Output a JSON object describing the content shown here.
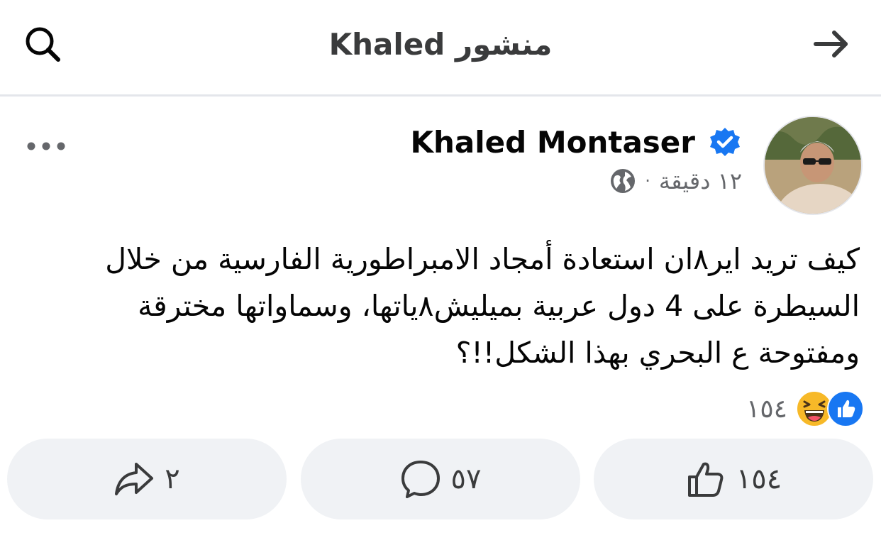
{
  "header": {
    "title": "منشور Khaled"
  },
  "post": {
    "author": "Khaled Montaser",
    "time": "١٢ دقيقة",
    "separator": "·",
    "text": "كيف تريد اير٨ان استعادة أمجاد الامبراطورية الفارسية من خلال السيطرة على 4 دول عربية بميليش٨ياتها، وسماواتها مخترقة ومفتوحة ع البحري بهذا الشكل!!؟"
  },
  "reactions": {
    "count": "١٥٤",
    "types": [
      "like",
      "haha"
    ]
  },
  "actions": {
    "like_count": "١٥٤",
    "comment_count": "٥٧",
    "share_count": "٢"
  },
  "icons": {
    "search": "search-icon",
    "back": "arrow-right-icon",
    "verified": "verified-badge-icon",
    "privacy": "globe-icon",
    "more": "more-dots-icon",
    "like": "thumbs-up-icon",
    "comment": "comment-bubble-icon",
    "share": "share-arrow-icon"
  },
  "colors": {
    "accent": "#1877f2",
    "muted": "#65676b",
    "button_bg": "#f0f2f5",
    "haha": "#f7b928"
  }
}
